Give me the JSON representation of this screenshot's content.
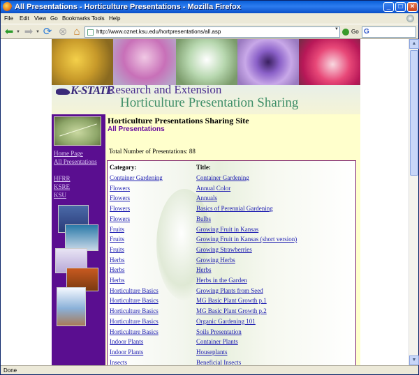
{
  "window": {
    "title": "All Presentations - Horticulture Presentations - Mozilla Firefox"
  },
  "menu": [
    "File",
    "Edit",
    "View",
    "Go",
    "Bookmarks",
    "Tools",
    "Help"
  ],
  "nav": {
    "url": "http://www.oznet.ksu.edu/hortpresentations/all.asp",
    "go_label": "Go"
  },
  "banner": {
    "ks_logo": "K-STATE",
    "research": "Research and Extension",
    "subtitle": "Horticulture Presentation Sharing"
  },
  "sidebar": {
    "links": [
      "Home Page",
      "All Presentations"
    ],
    "links2": [
      "HFRR",
      "KSRE",
      "KSU"
    ]
  },
  "content": {
    "title": "Horticulture Presentations Sharing Site",
    "subtitle": "All Presentations",
    "total": "Total Number of Presentations: 88",
    "col_category": "Category:",
    "col_title": "Title:",
    "rows": [
      {
        "category": "Container Gardening",
        "title": "Container Gardening"
      },
      {
        "category": "Flowers",
        "title": "Annual Color"
      },
      {
        "category": "Flowers",
        "title": "Annuals"
      },
      {
        "category": "Flowers",
        "title": "Basics of Perennial Gardening"
      },
      {
        "category": "Flowers",
        "title": "Bulbs"
      },
      {
        "category": "Fruits",
        "title": "Growing Fruit in Kansas"
      },
      {
        "category": "Fruits",
        "title": "Growing Fruit in Kansas (short version)"
      },
      {
        "category": "Fruits",
        "title": "Growing Strawberries"
      },
      {
        "category": "Herbs",
        "title": "Growing Herbs"
      },
      {
        "category": "Herbs",
        "title": "Herbs"
      },
      {
        "category": "Herbs",
        "title": "Herbs in the Garden"
      },
      {
        "category": "Horticulture Basics",
        "title": "Growing Plants from Seed"
      },
      {
        "category": "Horticulture Basics",
        "title": "MG Basic Plant Growth p.1"
      },
      {
        "category": "Horticulture Basics",
        "title": "MG Basic Plant Growth p.2"
      },
      {
        "category": "Horticulture Basics",
        "title": "Organic Gardening 101"
      },
      {
        "category": "Horticulture Basics",
        "title": "Soils Presentation"
      },
      {
        "category": "Indoor Plants",
        "title": "Container Plants"
      },
      {
        "category": "Indoor Plants",
        "title": "Houseplants"
      },
      {
        "category": "Insects",
        "title": "Beneficial Insects"
      }
    ]
  },
  "status": "Done"
}
